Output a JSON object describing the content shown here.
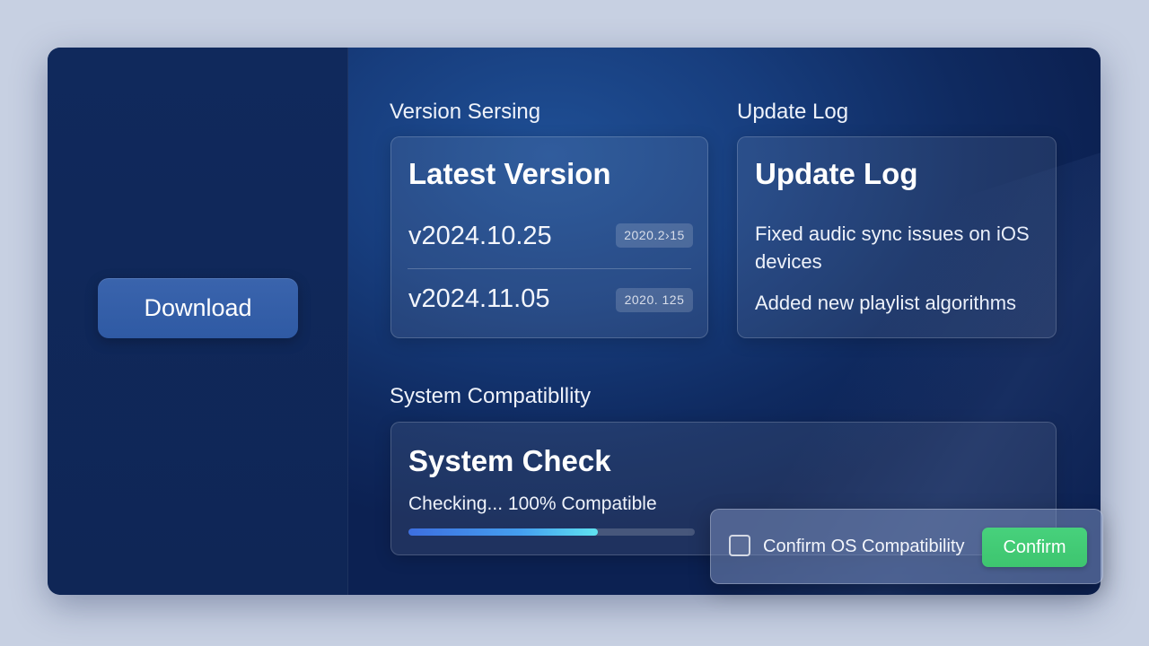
{
  "sidebar": {
    "download_label": "Download"
  },
  "version_section": {
    "title": "Version Sersing",
    "card_heading": "Latest Version",
    "versions": [
      {
        "label": "v2024.10.25",
        "badge": "2020.2›15"
      },
      {
        "label": "v2024.11.05",
        "badge": "2020. 125"
      }
    ]
  },
  "update_section": {
    "title": "Update Log",
    "card_heading": "Update Log",
    "entries": [
      "Fixed audic sync issues on iOS devices",
      "Added new playlist algorithms"
    ]
  },
  "compat_section": {
    "title": "System Compatibllity",
    "card_heading": "System Check",
    "status": "Checking... 100% Compatible",
    "progress_fraction": 0.66
  },
  "confirm_popup": {
    "checkbox_label": "Confirm OS Compatibility",
    "checked": false,
    "button_label": "Confirm"
  },
  "colors": {
    "accent_blue": "#2f5aa4",
    "confirm_green": "#3ec56f",
    "progress_cyan": "#5fe3f0"
  }
}
